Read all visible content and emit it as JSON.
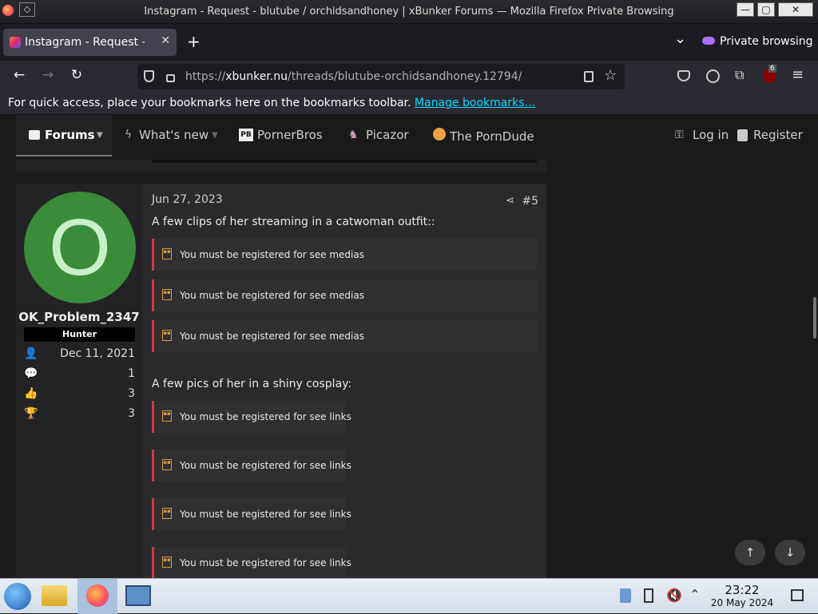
{
  "window": {
    "title": "Instagram - Request - blutube / orchidsandhoney | xBunker Forums — Mozilla Firefox Private Browsing",
    "buttons": {
      "minimize": "—",
      "maximize": "▢",
      "close": "✕"
    }
  },
  "tabs": [
    {
      "label": "Instagram - Request - blutube / orchidsandhoney",
      "close": "✕"
    }
  ],
  "tabbar": {
    "new_tab": "+",
    "list_all": "⌄",
    "private_label": "Private browsing"
  },
  "navbar": {
    "back": "←",
    "forward": "→",
    "reload": "↻",
    "url_prefix": "https://",
    "url_domain": "xbunker.nu",
    "url_path": "/threads/blutube-orchidsandhoney.12794/",
    "ext_badge": "6"
  },
  "bookmarks_bar": {
    "text": "For quick access, place your bookmarks here on the bookmarks toolbar.",
    "link": "Manage bookmarks…"
  },
  "site_nav": {
    "forums": "Forums",
    "whats_new": "What's new",
    "pornerbros_badge": "PB",
    "pornerbros": "PornerBros",
    "picazor": "Picazor",
    "porndude": "The PornDude",
    "login": "Log in",
    "register": "Register"
  },
  "post": {
    "user": {
      "avatar_letter": "O",
      "name": "OK_Problem_2347",
      "rank": "Hunter",
      "joined": "Dec 11, 2021",
      "messages": "1",
      "reactions": "3",
      "points": "3"
    },
    "date": "Jun 27, 2023",
    "number": "#5",
    "text1": "A few clips of her streaming in a catwoman outfit::",
    "media_notice": "You must be registered for see medias",
    "text2": "A few pics of her in a shiny cosplay:",
    "link_notice": "You must be registered for see links"
  },
  "fab": {
    "up": "↑",
    "down": "↓"
  },
  "taskbar": {
    "time": "23:22",
    "date": "20 May 2024"
  },
  "colors": {
    "accent": "#d13b3b",
    "avatar": "#3a8c3a",
    "link": "#00ddff"
  }
}
